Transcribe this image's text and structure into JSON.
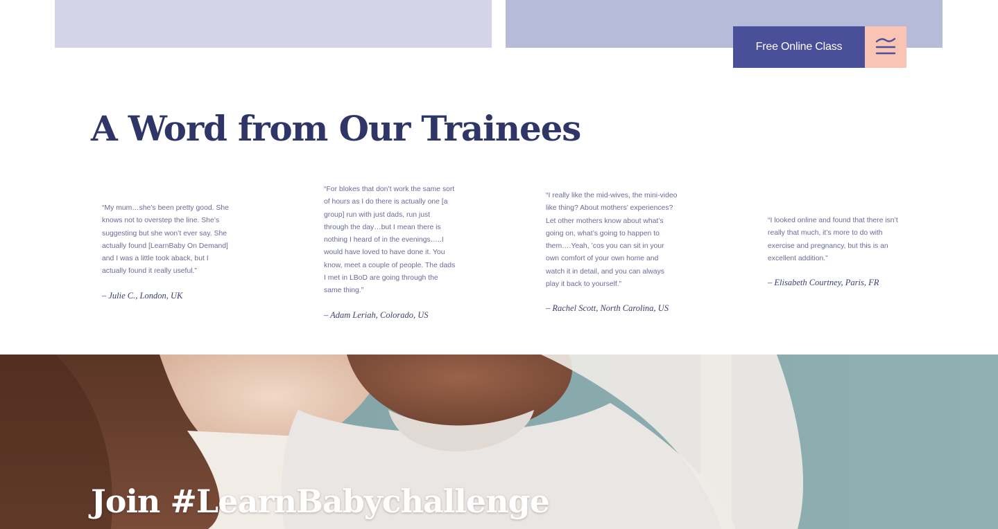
{
  "header": {
    "cta_label": "Free Online Class",
    "menu_icon": "menu-icon"
  },
  "testimonials_section": {
    "title": "A Word from Our Trainees",
    "items": [
      {
        "quote": "“My mum…she’s been pretty good. She knows not to overstep the line. She’s suggesting but she won’t ever say. She actually found [LearnBaby On Demand] and I was a little took aback, but I actually found it really useful.”",
        "author": "– Julie C., London, UK"
      },
      {
        "quote": "“For blokes that don’t work the same sort of hours as I do there is actually one [a group] run with just dads, run just through the day…but I mean there is nothing I heard of in the evenings…..I would have loved to have done it. You know, meet a couple of people. The dads I met in LBoD are going through the same thing.”",
        "author": "– Adam Leriah, Colorado, US"
      },
      {
        "quote": "“I really like the mid-wives, the mini-video like thing? About mothers’ experiences? Let other mothers know about what’s going on, what’s going to happen to them….Yeah, ’cos you can sit in your own comfort of your own home and watch it in detail, and you can always play it back to yourself.”",
        "author": "– Rachel Scott, North Carolina, US"
      },
      {
        "quote": "“I looked online and found that there isn’t really that much, it’s more to do with exercise and pregnancy, but this is an excellent addition.”",
        "author": "– Elisabeth Courtney, Paris, FR"
      }
    ]
  },
  "hero": {
    "title": "Join #LearnBabychallenge"
  },
  "colors": {
    "primary_navy": "#2f3567",
    "button_purple": "#4a4f9a",
    "menu_peach": "#f9c4b3",
    "card_light_lavender": "#d3d4e6",
    "card_lavender": "#b7bbda"
  }
}
